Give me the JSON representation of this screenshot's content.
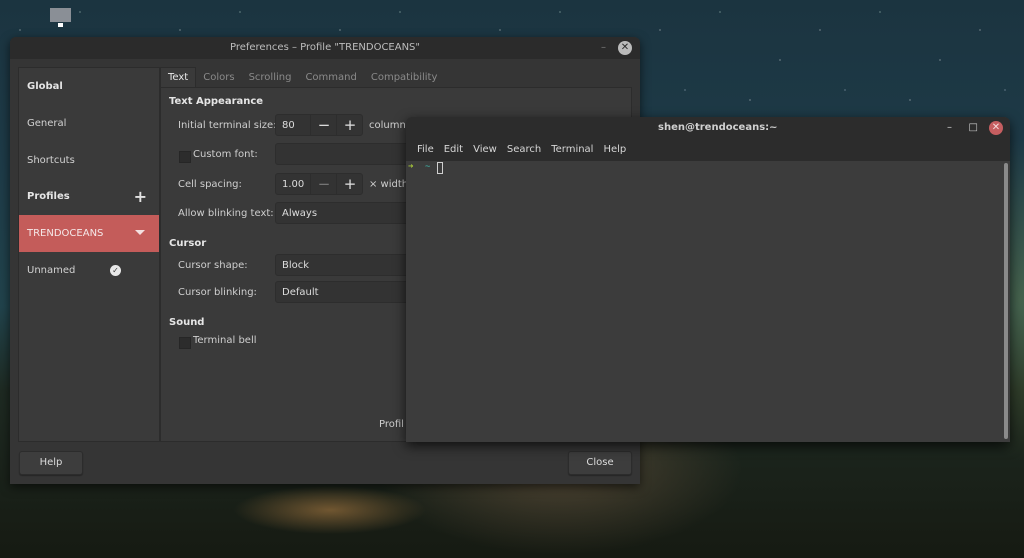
{
  "prefs": {
    "title": "Preferences – Profile \"TRENDOCEANS\"",
    "minimize_glyph": "–",
    "close_glyph": "✕",
    "sidebar": {
      "global_heading": "Global",
      "items_global": [
        "General",
        "Shortcuts"
      ],
      "profiles_heading": "Profiles",
      "add_glyph": "+",
      "profiles": [
        {
          "name": "TRENDOCEANS",
          "selected": true
        },
        {
          "name": "Unnamed",
          "default": true
        }
      ],
      "check_glyph": "✓"
    },
    "tabs": [
      "Text",
      "Colors",
      "Scrolling",
      "Command",
      "Compatibility"
    ],
    "active_tab": "Text",
    "text_appearance": {
      "heading": "Text Appearance",
      "initial_size_label": "Initial terminal size:",
      "columns_value": "80",
      "columns_unit": "columns",
      "custom_font_label": "Custom font:",
      "custom_font_checked": false,
      "cell_spacing_label": "Cell spacing:",
      "cell_spacing_value": "1.00",
      "cell_spacing_unit": "× width",
      "blinking_text_label": "Allow blinking text:",
      "blinking_text_value": "Always"
    },
    "cursor": {
      "heading": "Cursor",
      "shape_label": "Cursor shape:",
      "shape_value": "Block",
      "blinking_label": "Cursor blinking:",
      "blinking_value": "Default"
    },
    "sound": {
      "heading": "Sound",
      "bell_label": "Terminal bell",
      "bell_checked": false
    },
    "footer_partial": "Profil",
    "help_button": "Help",
    "close_button": "Close",
    "spin_minus": "−",
    "spin_plus": "+"
  },
  "terminal": {
    "title": "shen@trendoceans:~",
    "minimize_glyph": "–",
    "maximize_glyph": "□",
    "close_glyph": "✕",
    "menu": [
      "File",
      "Edit",
      "View",
      "Search",
      "Terminal",
      "Help"
    ],
    "prompt_arrow": "➜",
    "prompt_dir": "~"
  },
  "colors": {
    "accent": "#c45c5a",
    "terminal_close": "#c65e60",
    "prompt_arrow": "#a8c93a",
    "prompt_dir": "#3fb5a8"
  }
}
